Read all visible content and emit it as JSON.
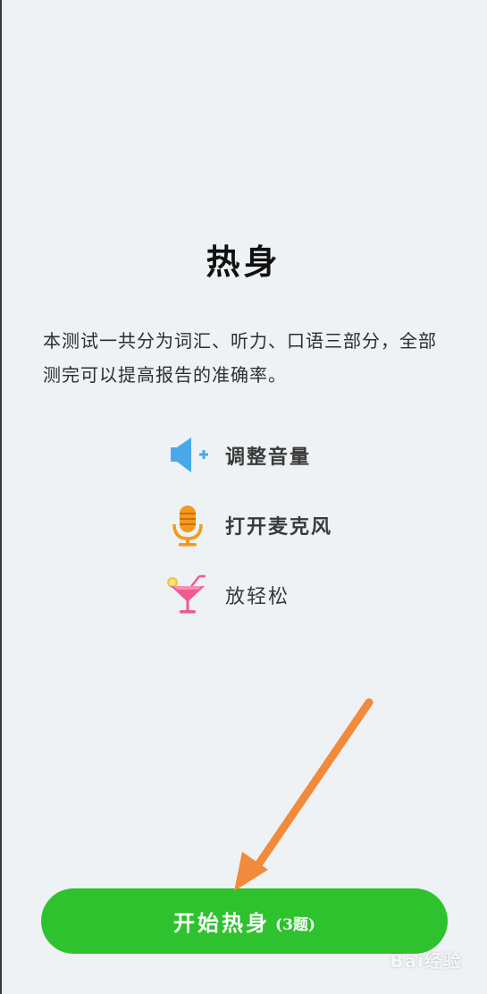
{
  "header": {
    "title": "热身"
  },
  "intro": {
    "line1": "本测试一共分为词汇、听力、口语三部分，全部",
    "line2": "测完可以提高报告的准确率。"
  },
  "steps": [
    {
      "label": "调整音量",
      "icon": "speaker-volume-up-icon",
      "color": "#4aa8e8"
    },
    {
      "label": "打开麦克风",
      "icon": "microphone-icon",
      "color": "#f39a1e"
    },
    {
      "label": "放轻松",
      "icon": "cocktail-icon",
      "color": "#ee5b8f"
    }
  ],
  "start": {
    "label": "开始热身",
    "count": "(3题)",
    "color": "#2ec22e"
  },
  "annotation": {
    "arrow_color": "#f28a3c"
  },
  "watermark": {
    "text": "Bai经验"
  }
}
